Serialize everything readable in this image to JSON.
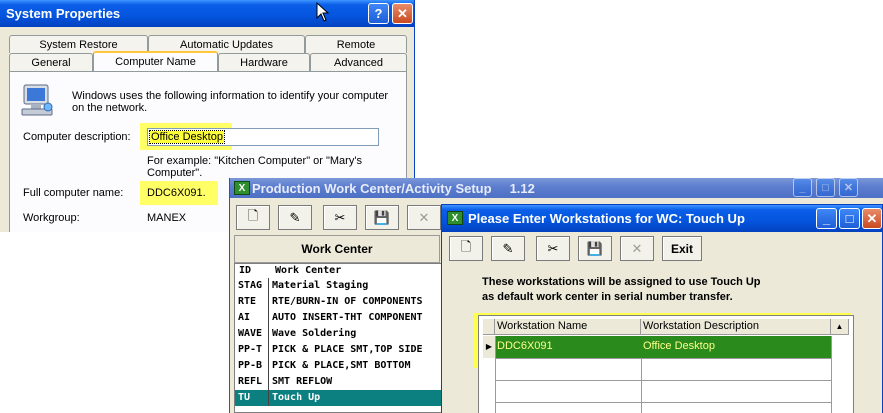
{
  "system_properties": {
    "title": "System Properties",
    "help_glyph": "?",
    "close_glyph": "✕",
    "tabs_row1": [
      "System Restore",
      "Automatic Updates",
      "Remote"
    ],
    "tabs_row2": [
      "General",
      "Computer Name",
      "Hardware",
      "Advanced"
    ],
    "active_tab": "Computer Name",
    "intro_text_line1": "Windows uses the following information to identify your computer",
    "intro_text_line2": "on the network.",
    "description_label": "Computer description:",
    "description_value": "Office Desktop",
    "example_line1": "For example: \"Kitchen Computer\" or \"Mary's",
    "example_line2": "Computer\".",
    "full_name_label": "Full computer name:",
    "full_name_value": "DDC6X091.",
    "workgroup_label": "Workgroup:",
    "workgroup_value": "MANEX"
  },
  "production_window": {
    "title": "Production Work Center/Activity Setup",
    "version": "1.12",
    "app_icon_text": "X",
    "toolbar_icons": [
      "new-icon",
      "edit-icon",
      "cut-icon",
      "save-icon",
      "delete-icon"
    ],
    "toolbar_glyphs": [
      "🗋",
      "✎",
      "✂",
      "💾",
      "✕"
    ],
    "list_title": "Work Center",
    "col_id": "ID",
    "col_name": "Work Center",
    "rows": [
      {
        "id": "STAG",
        "name": "Material Staging"
      },
      {
        "id": "RTE",
        "name": "RTE/BURN-IN OF COMPONENTS"
      },
      {
        "id": "AI",
        "name": "AUTO INSERT-THT COMPONENT"
      },
      {
        "id": "WAVE",
        "name": "Wave Soldering"
      },
      {
        "id": "PP-T",
        "name": "PICK & PLACE SMT,TOP SIDE"
      },
      {
        "id": "PP-B",
        "name": "PICK & PLACE,SMT BOTTOM"
      },
      {
        "id": "REFL",
        "name": "SMT REFLOW"
      },
      {
        "id": "TU",
        "name": "Touch Up"
      }
    ],
    "selected_row": "TU"
  },
  "workstations_window": {
    "title": "Please Enter Workstations for WC: Touch Up",
    "app_icon_text": "X",
    "toolbar_glyphs": [
      "🗋",
      "✎",
      "✂",
      "💾",
      "✕"
    ],
    "exit_label": "Exit",
    "note_line1": "These workstations will be assigned to use Touch Up",
    "note_line2": "as default work center in serial number transfer.",
    "col_name": "Workstation Name",
    "col_desc": "Workstation Description",
    "rows": [
      {
        "name": "DDC6X091",
        "description": "Office Desktop"
      }
    ]
  },
  "colors": {
    "xp_title_blue": "#0554dd",
    "highlight_yellow": "#ffff66",
    "selected_teal": "#0c7f80",
    "grid_row_green": "#2a8a1c"
  }
}
